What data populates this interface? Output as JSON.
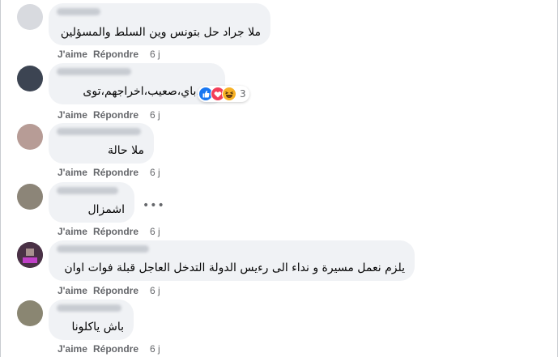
{
  "comments": [
    {
      "text": "ملا جراد حل بتونس وين السلط والمسؤلين",
      "like": "J'aime",
      "reply": "Répondre",
      "time": "6 j"
    },
    {
      "text": "باي،باي،صعيب،اخراجهم،توى",
      "like": "J'aime",
      "reply": "Répondre",
      "time": "6 j",
      "reaction_count": "3",
      "reaction_icons": [
        "like-icon",
        "love-icon",
        "haha-icon"
      ]
    },
    {
      "text": "ملا حالة",
      "like": "J'aime",
      "reply": "Répondre",
      "time": "6 j"
    },
    {
      "text": "اشمزال",
      "like": "J'aime",
      "reply": "Répondre",
      "time": "6 j"
    },
    {
      "text": "يلزم نعمل مسيرة و نداء الى رءيس الدولة التدخل العاجل قبلة فوات اوان",
      "like": "J'aime",
      "reply": "Répondre",
      "time": "6 j"
    },
    {
      "text": "باش ياكلونا",
      "like": "J'aime",
      "reply": "Répondre",
      "time": "6 j"
    }
  ],
  "more_icon": "more-options-icon",
  "colors": {
    "bubble": "#f0f2f5",
    "meta": "#65676b",
    "text": "#050505",
    "like_blue": "#1877f2",
    "love_red": "#f33e58",
    "haha_yellow": "#f7b125"
  }
}
